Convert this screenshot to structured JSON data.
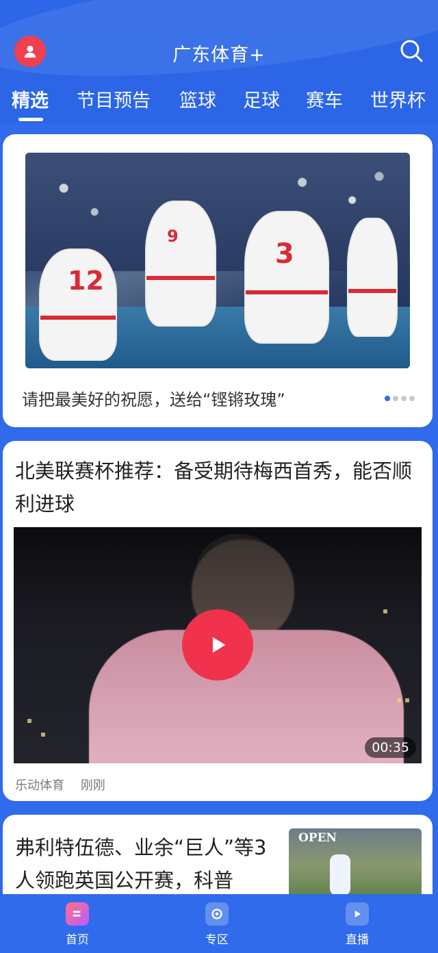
{
  "header": {
    "title": "广东体育+"
  },
  "tabs": [
    {
      "label": "精选",
      "active": true
    },
    {
      "label": "节目预告"
    },
    {
      "label": "篮球"
    },
    {
      "label": "足球"
    },
    {
      "label": "赛车"
    },
    {
      "label": "世界杯"
    }
  ],
  "hero": {
    "caption": "请把最美好的祝愿，送给“铿锵玫瑰”",
    "jersey_numbers": [
      "12",
      "9",
      "3"
    ]
  },
  "news1": {
    "title": "北美联赛杯推荐：备受期待梅西首秀，能否顺利进球",
    "duration": "00:35",
    "source": "乐动体育",
    "time": "刚刚"
  },
  "news2": {
    "title": "弗利特伍德、业余“巨人”等3人领跑英国公开赛，科普",
    "thumb_text": "OPEN"
  },
  "bottom_nav": [
    {
      "label": "首页",
      "icon": "home-icon"
    },
    {
      "label": "专区",
      "icon": "zone-icon"
    },
    {
      "label": "直播",
      "icon": "live-tv-icon"
    }
  ],
  "colors": {
    "primary": "#2f6bea",
    "accent_red": "#f1324c"
  }
}
